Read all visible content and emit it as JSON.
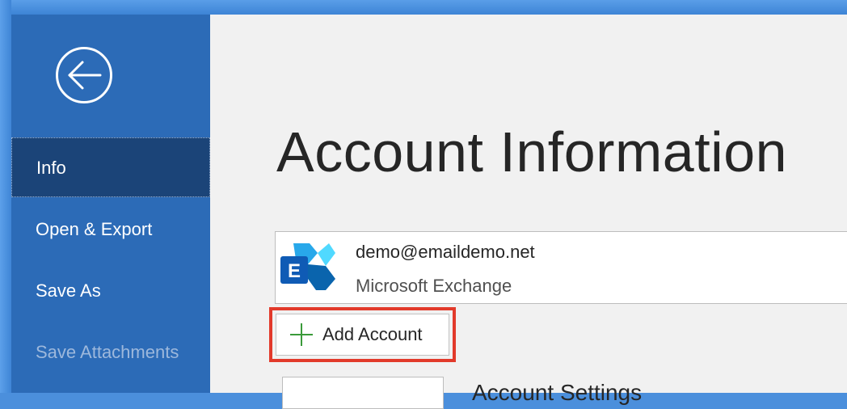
{
  "sidebar": {
    "back_icon": "back-arrow-icon",
    "items": [
      {
        "label": "Info",
        "active": true
      },
      {
        "label": "Open & Export"
      },
      {
        "label": "Save As"
      },
      {
        "label": "Save Attachments",
        "disabled": true
      }
    ]
  },
  "main": {
    "title": "Account Information",
    "account": {
      "email": "demo@emaildemo.net",
      "type": "Microsoft Exchange",
      "icon": "exchange-icon"
    },
    "add_account": {
      "label": "Add Account",
      "icon": "plus-icon",
      "highlight_color": "#e23a2b"
    },
    "account_settings": {
      "label": "Account Settings"
    }
  },
  "colors": {
    "sidebar_bg": "#2c6bb7",
    "sidebar_active_bg": "#1b4478",
    "main_bg": "#f1f1f1",
    "plus_green": "#3a9a3a"
  }
}
